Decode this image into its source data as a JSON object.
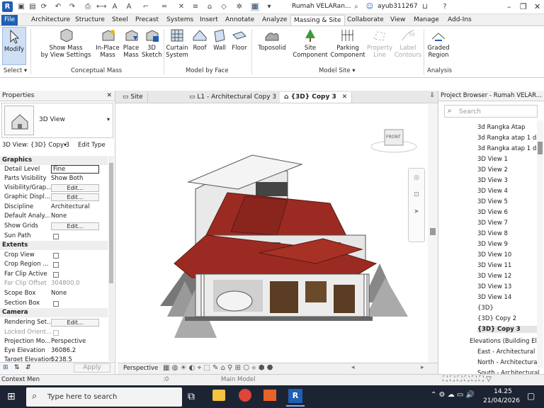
{
  "app": {
    "logo": "R",
    "title": "Rumah VELARan...",
    "user": "ayub311267"
  },
  "tabs": [
    "File",
    "Architecture",
    "Structure",
    "Steel",
    "Precast",
    "Systems",
    "Insert",
    "Annotate",
    "Analyze",
    "Massing & Site",
    "Collaborate",
    "View",
    "Manage",
    "Add-Ins"
  ],
  "active_tab": "Massing & Site",
  "ribbon": {
    "modify": "Modify",
    "select": "Select ▾",
    "show_mass": "Show Mass",
    "show_mass2": "by View Settings",
    "inplace": "In-Place",
    "inplace2": "Mass",
    "place": "Place",
    "place2": "Mass",
    "sketch3d": "3D",
    "sketch3d2": "Sketch",
    "curtain": "Curtain",
    "curtain2": "System",
    "roof": "Roof",
    "wall": "Wall",
    "floor": "Floor",
    "toposolid": "Toposolid",
    "site": "Site",
    "site2": "Component",
    "parking": "Parking",
    "parking2": "Component",
    "property": "Property",
    "property2": "Line",
    "label": "Label",
    "label2": "Contours",
    "graded": "Graded",
    "graded2": "Region",
    "groups": {
      "conceptual": "Conceptual Mass",
      "model_face": "Model by Face",
      "model_site": "Model Site ▾",
      "analysis": "Analysis"
    }
  },
  "properties": {
    "title": "Properties",
    "type": "3D View",
    "selector": "3D View: {3D} Copy 3",
    "edit_type": "Edit Type",
    "sections": {
      "graphics": "Graphics",
      "extents": "Extents",
      "camera": "Camera"
    },
    "rows": {
      "detail_level": [
        "Detail Level",
        "Fine"
      ],
      "parts_visibility": [
        "Parts Visibility",
        "Show Both"
      ],
      "visibility": [
        "Visibility/Grap..."
      ],
      "graphic_display": [
        "Graphic Displ..."
      ],
      "discipline": [
        "Discipline",
        "Architectural"
      ],
      "default_analysis": [
        "Default Analy...",
        "None"
      ],
      "show_grids": [
        "Show Grids"
      ],
      "sun_path": [
        "Sun Path"
      ],
      "crop_view": [
        "Crop View"
      ],
      "crop_region": [
        "Crop Region ..."
      ],
      "far_clip_active": [
        "Far Clip Active"
      ],
      "far_clip_offset": [
        "Far Clip Offset",
        "304800.0"
      ],
      "scope_box": [
        "Scope Box",
        "None"
      ],
      "section_box": [
        "Section Box"
      ],
      "rendering": [
        "Rendering Set..."
      ],
      "locked": [
        "Locked Orient..."
      ],
      "projection": [
        "Projection Mo...",
        "Perspective"
      ],
      "eye_elevation": [
        "Eye Elevation",
        "36086.2"
      ],
      "target_elevation": [
        "Target Elevation",
        "5238.5"
      ]
    },
    "edit_label": "Edit...",
    "apply": "Apply"
  },
  "viewtabs": [
    "Site",
    "L1 - Architectural Copy 3",
    "{3D} Copy 3"
  ],
  "viewcube": "FRONT",
  "viewbar": {
    "mode": "Perspective"
  },
  "browser": {
    "title": "Project Browser - Rumah VELAR...",
    "search_placeholder": "Search",
    "items": [
      "3d Rangka Atap",
      "3d Rangka atap 1 da",
      "3d Rangka atap 1 da",
      "3D View 1",
      "3D View 2",
      "3D View 3",
      "3D View 4",
      "3D View 5",
      "3D View 6",
      "3D View 7",
      "3D View 8",
      "3D View 9",
      "3D View 10",
      "3D View 11",
      "3D View 12",
      "3D View 13",
      "3D View 14",
      "{3D}",
      "{3D} Copy 2",
      "{3D} Copy 3"
    ],
    "elevations": "Elevations (Building Elev",
    "elev_items": [
      "East - Architectural",
      "North - Architectural",
      "South - Architectural"
    ]
  },
  "status": {
    "left": "Context Men",
    "zero": ":0",
    "model": "Main Model"
  },
  "taskbar": {
    "search": "Type here to search",
    "time": "14.25",
    "date": "21/04/2026"
  },
  "colors": {
    "accent": "#1f5fb4",
    "roof": "#9b2b22",
    "taskbar": "#1c2433"
  }
}
